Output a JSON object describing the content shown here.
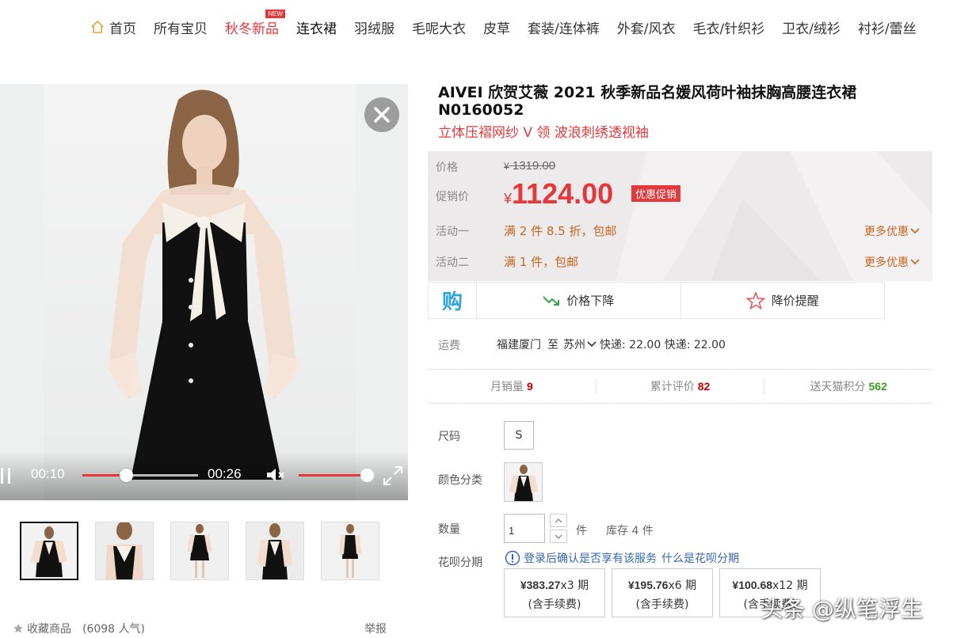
{
  "nav": {
    "home": "首页",
    "items": [
      "所有宝贝",
      "秋冬新品",
      "连衣裙",
      "羽绒服",
      "毛呢大衣",
      "皮草",
      "套装/连体裤",
      "外套/风衣",
      "毛衣/针织衫",
      "卫衣/绒衫",
      "衬衫/蕾丝"
    ],
    "new_badge": "NEW"
  },
  "video": {
    "current_time": "00:10",
    "total_time": "00:26",
    "progress": 0.38,
    "volume": 1.0
  },
  "product": {
    "title": "AIVEI 欣贺艾薇 2021 秋季新品名媛风荷叶袖抹胸高腰连衣裙 N0160052",
    "subtitle": "立体压褶网纱 V 领 波浪刺绣透视袖"
  },
  "price": {
    "price_label": "价格",
    "yen": "¥",
    "original": "1319.00",
    "promo_label": "促销价",
    "promo": "1124.00",
    "promo_badge": "优惠促销",
    "activity1_label": "活动一",
    "activity1": "满 2 件 8.5 折，包邮",
    "activity2_label": "活动二",
    "activity2": "满 1 件，包邮",
    "more": "更多优惠"
  },
  "actions": {
    "price_drop": "价格下降",
    "price_alert": "降价提醒",
    "buy_icon_text": "购"
  },
  "shipping": {
    "label": "运费",
    "from": "福建厦门",
    "to_word": "至",
    "to": "苏州",
    "express": "快递: 22.00 快递: 22.00"
  },
  "stats": {
    "monthly_sales_label": "月销量",
    "monthly_sales": "9",
    "reviews_label": "累计评价",
    "reviews": "82",
    "points_label": "送天猫积分",
    "points": "562"
  },
  "options": {
    "size_label": "尺码",
    "size": "S",
    "color_label": "颜色分类",
    "qty_label": "数量",
    "qty": "1",
    "qty_unit": "件",
    "stock": "库存 4 件",
    "huabei_label": "花呗分期",
    "huabei_note": "登录后确认是否享有该服务",
    "huabei_link": "什么是花呗分期",
    "installments": [
      {
        "amount": "¥383.27",
        "periods": "x3 期",
        "fee": "(含手续费)"
      },
      {
        "amount": "¥195.76",
        "periods": "x6 期",
        "fee": "(含手续费)"
      },
      {
        "amount": "¥100.68",
        "periods": "x12 期",
        "fee": "(含手续费)"
      }
    ]
  },
  "footer": {
    "collect": "收藏商品",
    "popularity": "(6098 人气)",
    "report": "举报"
  },
  "watermark": "头条 @纵笔浮生",
  "colors": {
    "accent": "#e4393c",
    "activity": "#c9651e",
    "link": "#3567b5",
    "points": "#3a9d23"
  }
}
